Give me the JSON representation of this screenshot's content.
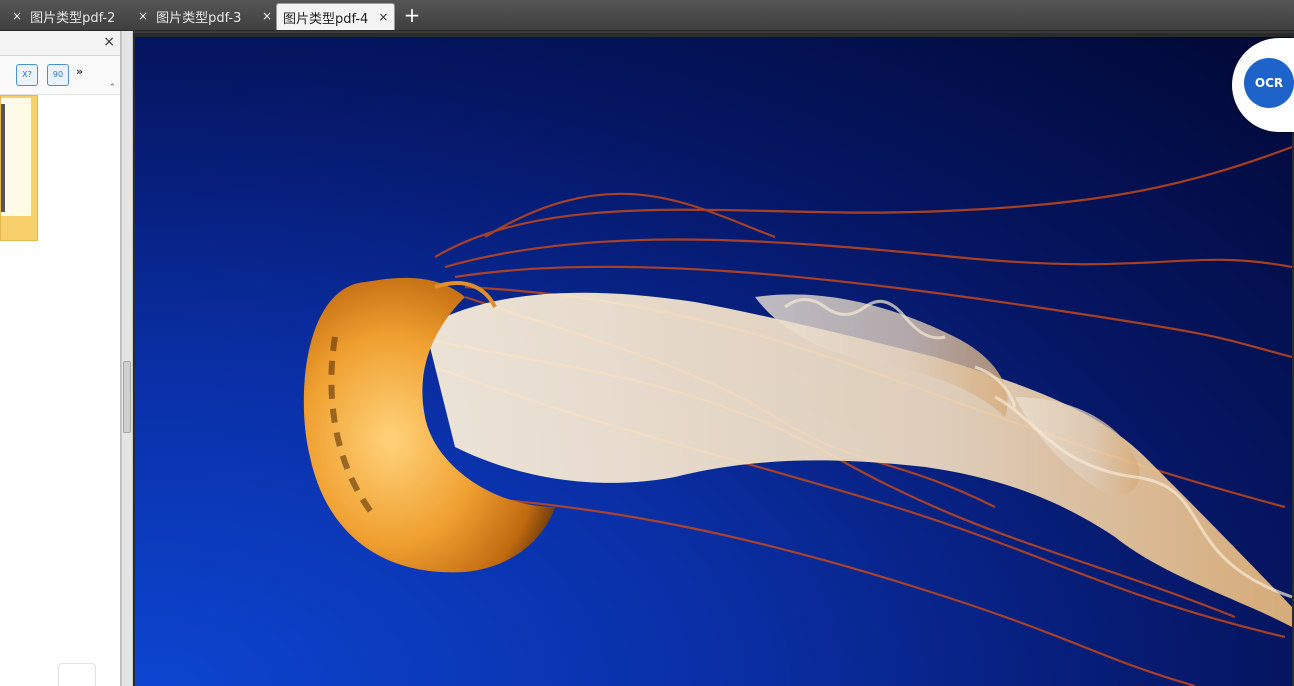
{
  "tabs": [
    {
      "label": "图片类型pdf-2",
      "active": false
    },
    {
      "label": "图片类型pdf-3",
      "active": false
    },
    {
      "label": "图片类型pdf-4",
      "active": true
    }
  ],
  "tab_close_glyph": "×",
  "add_tab_glyph": "+",
  "panel": {
    "close_glyph": "×",
    "tools": [
      {
        "icon": "rotate-left-page-icon",
        "text": "X?"
      },
      {
        "icon": "rotate-right-page-icon",
        "text": "90"
      }
    ],
    "more_glyph": "»",
    "collapse_glyph": "⌃"
  },
  "ocr_label": "OCR",
  "colors": {
    "tab_active_bg": "#f4f4f4",
    "thumb_highlight": "#f7cf6b",
    "ocr_blue": "#1e63c9",
    "ocean_deep": "#020a3a",
    "ocean_light": "#0a3bc2",
    "jelly_orange": "#e88a14"
  }
}
